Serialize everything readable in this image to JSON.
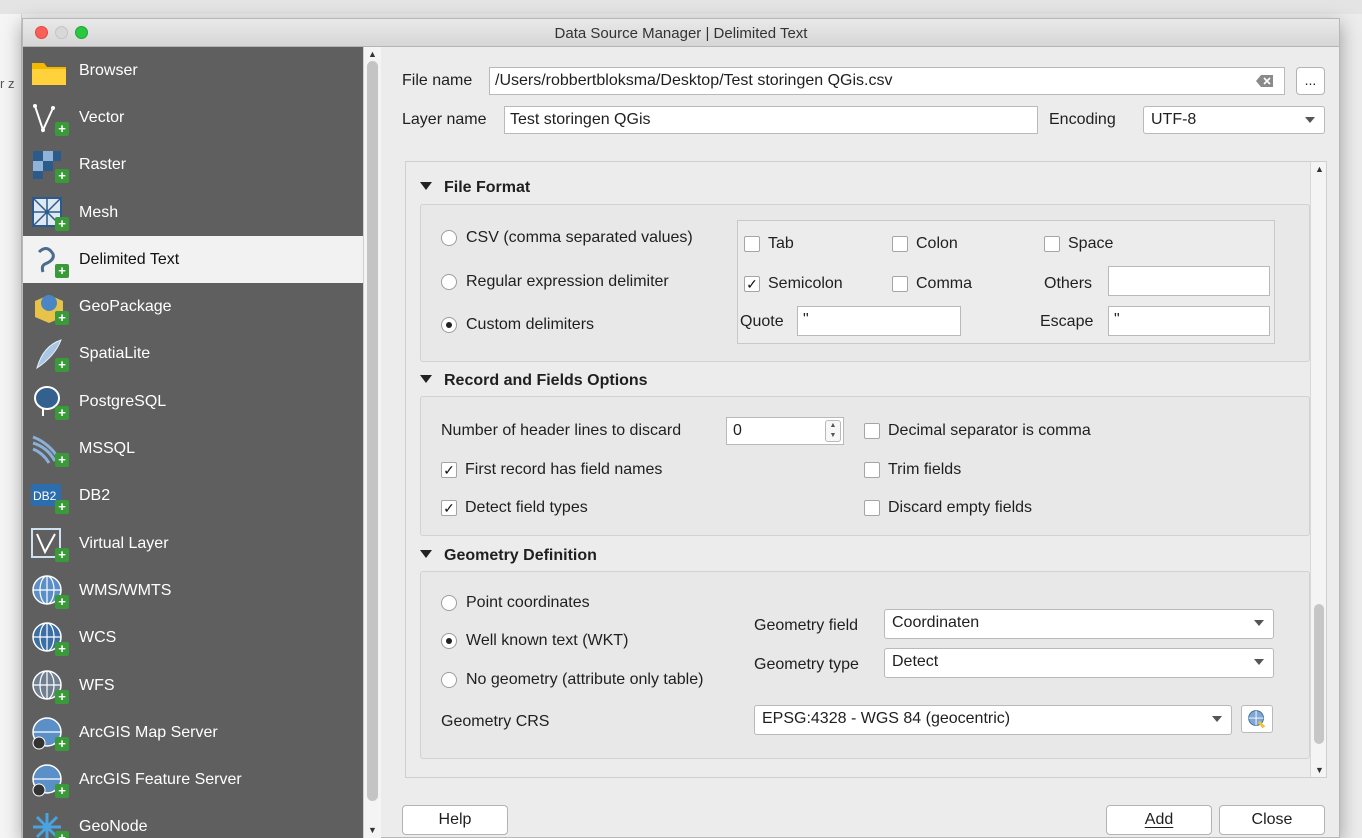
{
  "window": {
    "title": "Data Source Manager | Delimited Text"
  },
  "background": {
    "partial_text": "r z"
  },
  "sidebar": {
    "items": [
      {
        "label": "Browser",
        "icon": "folder-icon",
        "active": false
      },
      {
        "label": "Vector",
        "icon": "vector-icon",
        "active": false
      },
      {
        "label": "Raster",
        "icon": "raster-icon",
        "active": false
      },
      {
        "label": "Mesh",
        "icon": "mesh-icon",
        "active": false
      },
      {
        "label": "Delimited Text",
        "icon": "delimited-text-icon",
        "active": true
      },
      {
        "label": "GeoPackage",
        "icon": "geopackage-icon",
        "active": false
      },
      {
        "label": "SpatiaLite",
        "icon": "spatialite-icon",
        "active": false
      },
      {
        "label": "PostgreSQL",
        "icon": "postgresql-icon",
        "active": false
      },
      {
        "label": "MSSQL",
        "icon": "mssql-icon",
        "active": false
      },
      {
        "label": "DB2",
        "icon": "db2-icon",
        "active": false
      },
      {
        "label": "Virtual Layer",
        "icon": "virtual-layer-icon",
        "active": false
      },
      {
        "label": "WMS/WMTS",
        "icon": "wms-globe-icon",
        "active": false
      },
      {
        "label": "WCS",
        "icon": "wcs-globe-icon",
        "active": false
      },
      {
        "label": "WFS",
        "icon": "wfs-globe-icon",
        "active": false
      },
      {
        "label": "ArcGIS Map Server",
        "icon": "arcgis-map-server-icon",
        "active": false
      },
      {
        "label": "ArcGIS Feature Server",
        "icon": "arcgis-feature-server-icon",
        "active": false
      },
      {
        "label": "GeoNode",
        "icon": "geonode-icon",
        "active": false
      }
    ]
  },
  "file": {
    "file_name_label": "File name",
    "file_name_value": "/Users/robbertbloksma/Desktop/Test storingen QGis.csv",
    "browse_label": "...",
    "layer_name_label": "Layer name",
    "layer_name_value": "Test storingen QGis",
    "encoding_label": "Encoding",
    "encoding_value": "UTF-8"
  },
  "file_format": {
    "title": "File Format",
    "radios": {
      "csv": "CSV (comma separated values)",
      "regex": "Regular expression delimiter",
      "custom": "Custom delimiters"
    },
    "selected": "custom",
    "checks": {
      "tab": "Tab",
      "colon": "Colon",
      "space": "Space",
      "semicolon": "Semicolon",
      "comma": "Comma"
    },
    "semicolon_checked": true,
    "others_label": "Others",
    "others_value": "",
    "quote_label": "Quote",
    "quote_value": "\"",
    "escape_label": "Escape",
    "escape_value": "\""
  },
  "record_options": {
    "title": "Record and Fields Options",
    "header_lines_label": "Number of header lines to discard",
    "header_lines_value": "0",
    "first_record": "First record has field names",
    "detect_types": "Detect field types",
    "decimal_comma": "Decimal separator is comma",
    "trim_fields": "Trim fields",
    "discard_empty": "Discard empty fields"
  },
  "geometry": {
    "title": "Geometry Definition",
    "point": "Point coordinates",
    "wkt": "Well known text (WKT)",
    "no_geom": "No geometry (attribute only table)",
    "selected": "wkt",
    "field_label": "Geometry field",
    "field_value": "Coordinaten",
    "type_label": "Geometry type",
    "type_value": "Detect",
    "crs_label": "Geometry CRS",
    "crs_value": "EPSG:4328 - WGS 84 (geocentric)"
  },
  "footer": {
    "help": "Help",
    "add": "Add",
    "close": "Close"
  },
  "colors": {
    "sidebar_bg": "#5f5f5f",
    "active_item_bg": "#f2f2f2",
    "add_plus_green": "#3a9a3a"
  }
}
